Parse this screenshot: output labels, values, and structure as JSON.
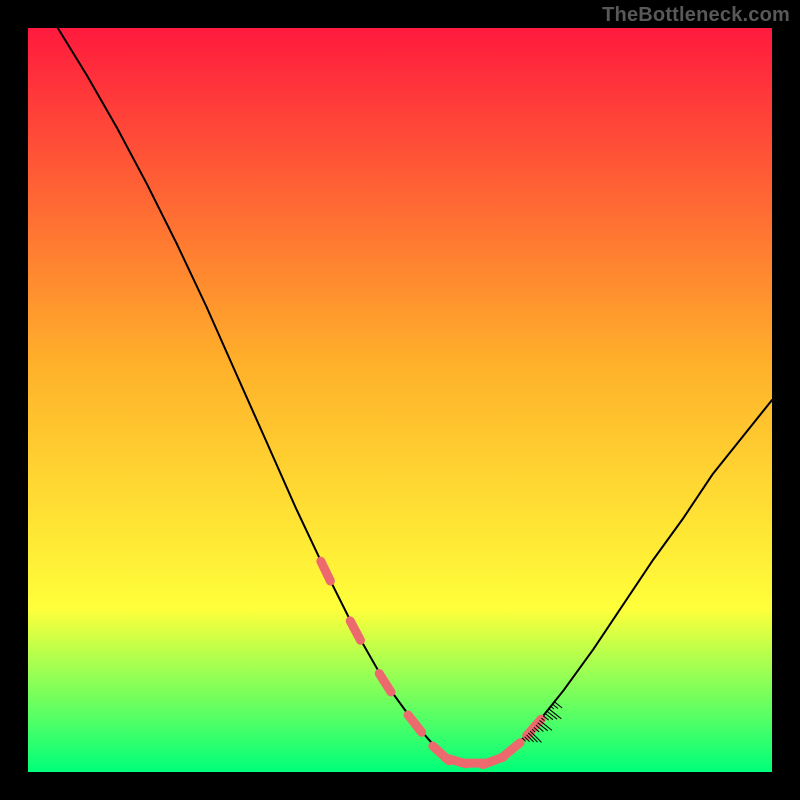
{
  "watermark": "TheBottleneck.com",
  "colors": {
    "gradient_top": "#ff1a3e",
    "gradient_mid": "#ffb02a",
    "gradient_low": "#ffff3a",
    "gradient_bottom": "#00ff7a",
    "curve": "#000000",
    "marker": "#ec6a6d",
    "border": "#000000"
  },
  "chart_data": {
    "type": "line",
    "title": "",
    "xlabel": "",
    "ylabel": "",
    "xlim": [
      0,
      1
    ],
    "ylim": [
      0,
      1
    ],
    "x": [
      0.04,
      0.08,
      0.12,
      0.16,
      0.2,
      0.24,
      0.28,
      0.32,
      0.36,
      0.4,
      0.44,
      0.48,
      0.52,
      0.555,
      0.575,
      0.6,
      0.625,
      0.65,
      0.68,
      0.72,
      0.76,
      0.8,
      0.84,
      0.88,
      0.92,
      0.96,
      1.0
    ],
    "values": [
      1.0,
      0.935,
      0.865,
      0.79,
      0.71,
      0.625,
      0.535,
      0.445,
      0.355,
      0.27,
      0.19,
      0.12,
      0.065,
      0.025,
      0.015,
      0.012,
      0.015,
      0.03,
      0.06,
      0.11,
      0.165,
      0.225,
      0.285,
      0.34,
      0.4,
      0.45,
      0.5
    ],
    "highlighted_region_x": [
      0.4,
      0.7
    ],
    "legend": []
  }
}
